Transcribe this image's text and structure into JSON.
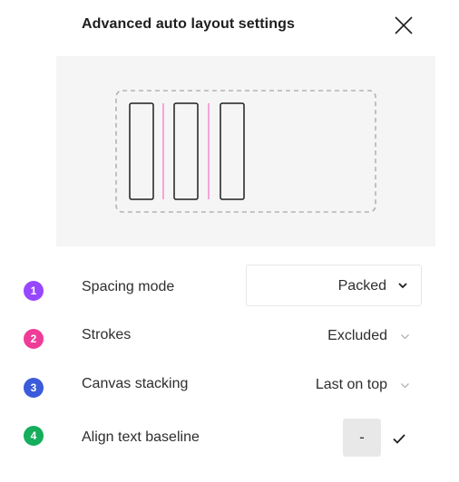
{
  "dialog": {
    "title": "Advanced auto layout settings",
    "close_icon": "close-icon"
  },
  "preview": {
    "accent_color": "#f27ad0",
    "frame_color": "#b3b3b3",
    "item_color": "#1e1e1e",
    "item_count": 3
  },
  "settings": [
    {
      "badge": "1",
      "badge_color": "#9747ff",
      "label": "Spacing mode",
      "value": "Packed",
      "chevron_icon": "chevron-down-icon"
    },
    {
      "badge": "2",
      "badge_color": "#ef3c98",
      "label": "Strokes",
      "value": "Excluded",
      "chevron_icon": "chevron-down-icon"
    },
    {
      "badge": "3",
      "badge_color": "#3b5bdb",
      "label": "Canvas stacking",
      "value": "Last on top",
      "chevron_icon": "chevron-down-icon"
    },
    {
      "badge": "4",
      "badge_color": "#14ae5c",
      "label": "Align text baseline",
      "options": [
        "-",
        "✓"
      ],
      "check_icon": "check-icon"
    }
  ]
}
